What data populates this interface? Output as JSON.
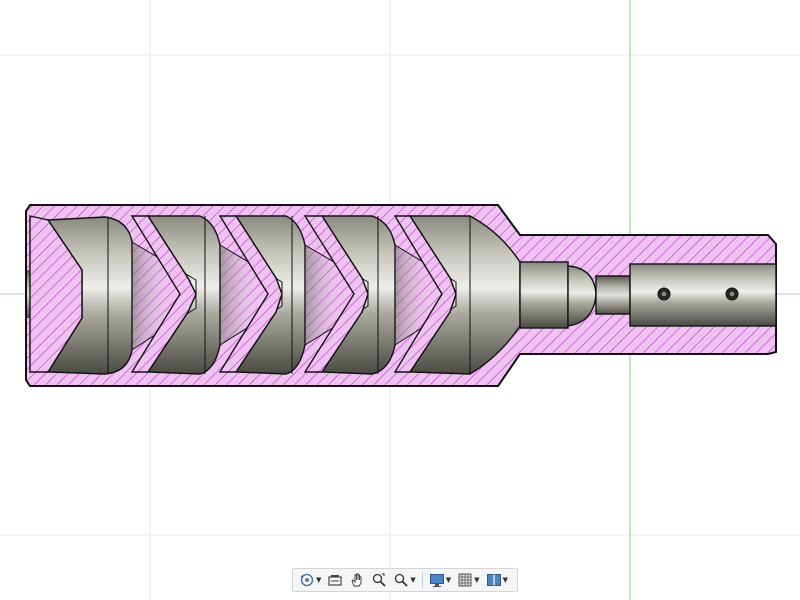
{
  "window": {
    "background": "#ffffff"
  },
  "colors": {
    "grid_line": "#e8e8e8",
    "origin_horizontal": "#c3c3f0",
    "origin_vertical": "#7fd07f",
    "section_fill": "#f0c2f2",
    "hatch": "#b43cc4",
    "outline": "#111111",
    "metal_light": "#e8e8e2",
    "metal_mid": "#a8a89c",
    "metal_dark": "#56564e"
  },
  "navigation_bar": {
    "tools": [
      {
        "id": "orbit",
        "icon": "orbit-icon",
        "has_menu": true
      },
      {
        "id": "look-at",
        "icon": "look-at-icon",
        "has_menu": false
      },
      {
        "id": "pan",
        "icon": "pan-hand-icon",
        "has_menu": false
      },
      {
        "id": "zoom",
        "icon": "zoom-icon",
        "has_menu": false
      },
      {
        "id": "fit",
        "icon": "zoom-window-icon",
        "has_menu": true
      },
      {
        "id": "display-settings",
        "icon": "display-settings-icon",
        "has_menu": true
      },
      {
        "id": "grid-snaps",
        "icon": "grid-icon",
        "has_menu": true
      },
      {
        "id": "viewports",
        "icon": "viewports-icon",
        "has_menu": true
      }
    ]
  }
}
